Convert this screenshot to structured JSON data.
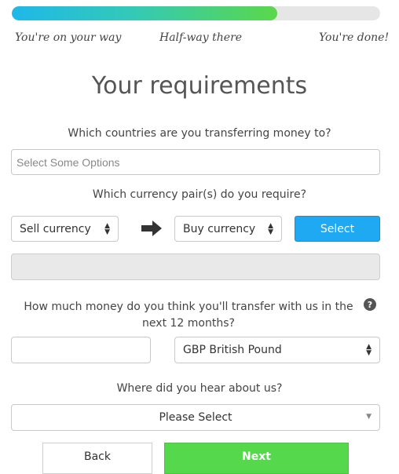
{
  "progress": {
    "fraction": 0.72,
    "gradient_start": "#1fb8e8",
    "gradient_end": "#5ad84a"
  },
  "steps": [
    "You're on your way",
    "Half-way there",
    "You're done!"
  ],
  "title": "Your requirements",
  "countries": {
    "question": "Which countries are you transferring money to?",
    "placeholder": "Select Some Options"
  },
  "currency_pair": {
    "question": "Which currency pair(s) do you require?",
    "sell_value": "Sell currency",
    "buy_value": "Buy currency",
    "arrow_icon": "arrow-right-icon",
    "select_label": "Select",
    "select_color": "#1ea9f2"
  },
  "amount": {
    "question_line1": "How much money do you think you'll transfer with us in the",
    "question_line2": "next 12 months?",
    "help_symbol": "?",
    "currency_value": "GBP British Pound"
  },
  "hear_about": {
    "question": "Where did you hear about us?",
    "value": "Please Select"
  },
  "nav": {
    "back_label": "Back",
    "next_label": "Next",
    "next_color": "#55d84c"
  }
}
